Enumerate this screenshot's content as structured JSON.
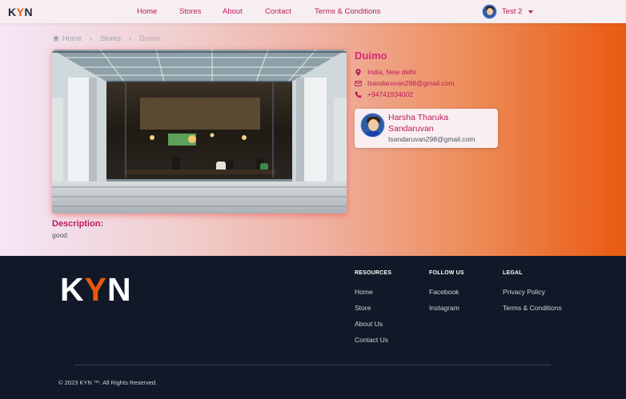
{
  "nav": {
    "logo_k": "K",
    "logo_y": "Y",
    "logo_n": "N",
    "links": [
      "Home",
      "Stores",
      "About",
      "Contact",
      "Terms & Conditions"
    ],
    "user_name": "Test 2"
  },
  "breadcrumb": {
    "home": "Home",
    "stores": "Stores",
    "current": "Duimo"
  },
  "store": {
    "name": "Duimo",
    "location": "India, New delhi",
    "email": "tsandaruvan298@gmail.com",
    "phone": "+94741934002",
    "description_label": "Description:",
    "description": "good"
  },
  "owner": {
    "name": "Harsha Tharuka Sandaruvan",
    "email": "tsandaruvan298@gmail.com"
  },
  "footer": {
    "logo_k": "K",
    "logo_y": "Y",
    "logo_n": "N",
    "resources_heading": "RESOURCES",
    "resources": [
      "Home",
      "Store",
      "About Us",
      "Contact Us"
    ],
    "follow_heading": "FOLLOW US",
    "follow": [
      "Facebook",
      "Instagram"
    ],
    "legal_heading": "LEGAL",
    "legal": [
      "Privacy Policy",
      "Terms & Conditions"
    ],
    "copyright": "© 2023 KYN ™. All Rights Reserved."
  },
  "colors": {
    "accent_pink": "#be185d",
    "accent_orange": "#ea580c",
    "footer_bg": "#111827"
  }
}
